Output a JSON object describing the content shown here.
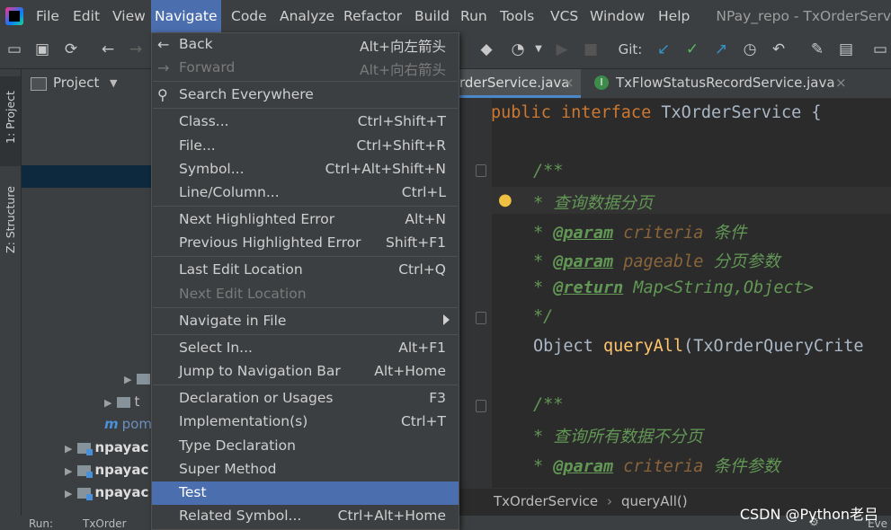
{
  "menubar": {
    "items": [
      {
        "label": "File"
      },
      {
        "label": "Edit"
      },
      {
        "label": "View"
      },
      {
        "label": "Navigate"
      },
      {
        "label": "Code"
      },
      {
        "label": "Analyze"
      },
      {
        "label": "Refactor"
      },
      {
        "label": "Build"
      },
      {
        "label": "Run"
      },
      {
        "label": "Tools"
      },
      {
        "label": "VCS"
      },
      {
        "label": "Window"
      },
      {
        "label": "Help"
      }
    ],
    "window_title": "NPay_repo - TxOrderServ"
  },
  "toolbar": {
    "git_label": "Git:"
  },
  "left_strip": {
    "project_tab": "1: Project",
    "structure_tab": "Z: Structure"
  },
  "project_panel": {
    "title": "Project",
    "tree": [
      {
        "label": ""
      },
      {
        "label": "t"
      },
      {
        "label": "pom"
      },
      {
        "label": "npayac"
      },
      {
        "label": "npayac"
      },
      {
        "label": "npayac"
      }
    ]
  },
  "editor_tabs": [
    {
      "label": "rderService.java"
    },
    {
      "label": "TxFlowStatusRecordService.java"
    }
  ],
  "code": {
    "line1": {
      "kw": "public interface ",
      "name": "TxOrderService",
      "rest": " {"
    },
    "doc_open": "/**",
    "doc_desc": "* 查询数据分页",
    "param1": {
      "star": "* ",
      "tag": "@param",
      "name": " criteria",
      "desc": " 条件"
    },
    "param2": {
      "star": "* ",
      "tag": "@param",
      "name": " pageable",
      "desc": " 分页参数"
    },
    "ret": {
      "star": "* ",
      "tag": "@return",
      "desc": " Map<String,Object>"
    },
    "doc_close": "*/",
    "method": {
      "type": "Object ",
      "name": "queryAll",
      "rest": "(TxOrderQueryCrite"
    },
    "doc2_open": "/**",
    "doc2_desc": "* 查询所有数据不分页",
    "param3": {
      "star": "* ",
      "tag": "@param",
      "name": " criteria",
      "desc": " 条件参数"
    }
  },
  "breadcrumb": {
    "class_name": "TxOrderService",
    "sep": "›",
    "method": "queryAll()"
  },
  "status": {
    "run_label": "Run:",
    "run_item": "TxOrder",
    "event_label": "Eve"
  },
  "navigate_menu": {
    "items": [
      {
        "label": "Back",
        "shortcut": "Alt+向左箭头",
        "icon": "arrow-left-icon",
        "enabled": true
      },
      {
        "label": "Forward",
        "shortcut": "Alt+向右箭头",
        "icon": "arrow-right-icon",
        "enabled": false
      },
      {
        "label": "Search Everywhere",
        "shortcut": "",
        "icon": "search-icon",
        "enabled": true
      },
      {
        "label": "Class...",
        "shortcut": "Ctrl+Shift+T",
        "enabled": true
      },
      {
        "label": "File...",
        "shortcut": "Ctrl+Shift+R",
        "enabled": true
      },
      {
        "label": "Symbol...",
        "shortcut": "Ctrl+Alt+Shift+N",
        "enabled": true
      },
      {
        "label": "Line/Column...",
        "shortcut": "Ctrl+L",
        "enabled": true
      },
      {
        "label": "Next Highlighted Error",
        "shortcut": "Alt+N",
        "enabled": true
      },
      {
        "label": "Previous Highlighted Error",
        "shortcut": "Shift+F1",
        "enabled": true
      },
      {
        "label": "Last Edit Location",
        "shortcut": "Ctrl+Q",
        "enabled": true
      },
      {
        "label": "Next Edit Location",
        "shortcut": "",
        "enabled": false
      },
      {
        "label": "Navigate in File",
        "shortcut": "",
        "enabled": true,
        "submenu": true
      },
      {
        "label": "Select In...",
        "shortcut": "Alt+F1",
        "enabled": true
      },
      {
        "label": "Jump to Navigation Bar",
        "shortcut": "Alt+Home",
        "enabled": true
      },
      {
        "label": "Declaration or Usages",
        "shortcut": "F3",
        "enabled": true
      },
      {
        "label": "Implementation(s)",
        "shortcut": "Ctrl+T",
        "enabled": true
      },
      {
        "label": "Type Declaration",
        "shortcut": "",
        "enabled": true
      },
      {
        "label": "Super Method",
        "shortcut": "",
        "enabled": true
      },
      {
        "label": "Test",
        "shortcut": "",
        "enabled": true,
        "selected": true
      },
      {
        "label": "Related Symbol...",
        "shortcut": "Ctrl+Alt+Home",
        "enabled": true
      }
    ]
  },
  "watermark": "CSDN @Python老吕",
  "colors": {
    "accent": "#4b6eaf",
    "menu_bg": "#3c3f41",
    "editor_bg": "#2b2b2b"
  }
}
